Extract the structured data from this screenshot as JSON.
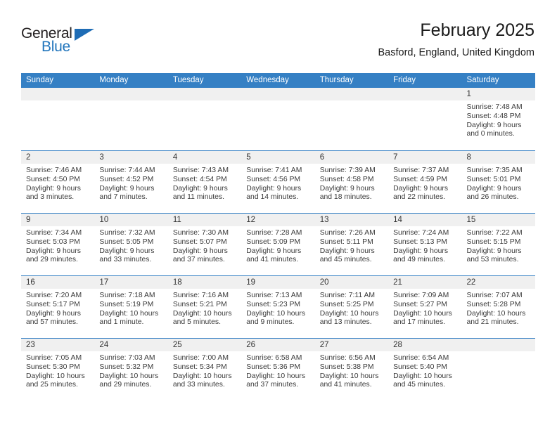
{
  "brand": {
    "name_part1": "General",
    "name_part2": "Blue",
    "triangle_icon": "triangle-icon",
    "accent_color": "#2175bc"
  },
  "header": {
    "title": "February 2025",
    "subtitle": "Basford, England, United Kingdom"
  },
  "calendar": {
    "header_bg": "#3580c4",
    "daynum_bg": "#f0f0f0",
    "weekday_headers": [
      "Sunday",
      "Monday",
      "Tuesday",
      "Wednesday",
      "Thursday",
      "Friday",
      "Saturday"
    ],
    "weeks": [
      [
        {
          "day": "",
          "empty": true
        },
        {
          "day": "",
          "empty": true
        },
        {
          "day": "",
          "empty": true
        },
        {
          "day": "",
          "empty": true
        },
        {
          "day": "",
          "empty": true
        },
        {
          "day": "",
          "empty": true
        },
        {
          "day": "1",
          "sunrise": "Sunrise: 7:48 AM",
          "sunset": "Sunset: 4:48 PM",
          "daylight1": "Daylight: 9 hours",
          "daylight2": "and 0 minutes."
        }
      ],
      [
        {
          "day": "2",
          "sunrise": "Sunrise: 7:46 AM",
          "sunset": "Sunset: 4:50 PM",
          "daylight1": "Daylight: 9 hours",
          "daylight2": "and 3 minutes."
        },
        {
          "day": "3",
          "sunrise": "Sunrise: 7:44 AM",
          "sunset": "Sunset: 4:52 PM",
          "daylight1": "Daylight: 9 hours",
          "daylight2": "and 7 minutes."
        },
        {
          "day": "4",
          "sunrise": "Sunrise: 7:43 AM",
          "sunset": "Sunset: 4:54 PM",
          "daylight1": "Daylight: 9 hours",
          "daylight2": "and 11 minutes."
        },
        {
          "day": "5",
          "sunrise": "Sunrise: 7:41 AM",
          "sunset": "Sunset: 4:56 PM",
          "daylight1": "Daylight: 9 hours",
          "daylight2": "and 14 minutes."
        },
        {
          "day": "6",
          "sunrise": "Sunrise: 7:39 AM",
          "sunset": "Sunset: 4:58 PM",
          "daylight1": "Daylight: 9 hours",
          "daylight2": "and 18 minutes."
        },
        {
          "day": "7",
          "sunrise": "Sunrise: 7:37 AM",
          "sunset": "Sunset: 4:59 PM",
          "daylight1": "Daylight: 9 hours",
          "daylight2": "and 22 minutes."
        },
        {
          "day": "8",
          "sunrise": "Sunrise: 7:35 AM",
          "sunset": "Sunset: 5:01 PM",
          "daylight1": "Daylight: 9 hours",
          "daylight2": "and 26 minutes."
        }
      ],
      [
        {
          "day": "9",
          "sunrise": "Sunrise: 7:34 AM",
          "sunset": "Sunset: 5:03 PM",
          "daylight1": "Daylight: 9 hours",
          "daylight2": "and 29 minutes."
        },
        {
          "day": "10",
          "sunrise": "Sunrise: 7:32 AM",
          "sunset": "Sunset: 5:05 PM",
          "daylight1": "Daylight: 9 hours",
          "daylight2": "and 33 minutes."
        },
        {
          "day": "11",
          "sunrise": "Sunrise: 7:30 AM",
          "sunset": "Sunset: 5:07 PM",
          "daylight1": "Daylight: 9 hours",
          "daylight2": "and 37 minutes."
        },
        {
          "day": "12",
          "sunrise": "Sunrise: 7:28 AM",
          "sunset": "Sunset: 5:09 PM",
          "daylight1": "Daylight: 9 hours",
          "daylight2": "and 41 minutes."
        },
        {
          "day": "13",
          "sunrise": "Sunrise: 7:26 AM",
          "sunset": "Sunset: 5:11 PM",
          "daylight1": "Daylight: 9 hours",
          "daylight2": "and 45 minutes."
        },
        {
          "day": "14",
          "sunrise": "Sunrise: 7:24 AM",
          "sunset": "Sunset: 5:13 PM",
          "daylight1": "Daylight: 9 hours",
          "daylight2": "and 49 minutes."
        },
        {
          "day": "15",
          "sunrise": "Sunrise: 7:22 AM",
          "sunset": "Sunset: 5:15 PM",
          "daylight1": "Daylight: 9 hours",
          "daylight2": "and 53 minutes."
        }
      ],
      [
        {
          "day": "16",
          "sunrise": "Sunrise: 7:20 AM",
          "sunset": "Sunset: 5:17 PM",
          "daylight1": "Daylight: 9 hours",
          "daylight2": "and 57 minutes."
        },
        {
          "day": "17",
          "sunrise": "Sunrise: 7:18 AM",
          "sunset": "Sunset: 5:19 PM",
          "daylight1": "Daylight: 10 hours",
          "daylight2": "and 1 minute."
        },
        {
          "day": "18",
          "sunrise": "Sunrise: 7:16 AM",
          "sunset": "Sunset: 5:21 PM",
          "daylight1": "Daylight: 10 hours",
          "daylight2": "and 5 minutes."
        },
        {
          "day": "19",
          "sunrise": "Sunrise: 7:13 AM",
          "sunset": "Sunset: 5:23 PM",
          "daylight1": "Daylight: 10 hours",
          "daylight2": "and 9 minutes."
        },
        {
          "day": "20",
          "sunrise": "Sunrise: 7:11 AM",
          "sunset": "Sunset: 5:25 PM",
          "daylight1": "Daylight: 10 hours",
          "daylight2": "and 13 minutes."
        },
        {
          "day": "21",
          "sunrise": "Sunrise: 7:09 AM",
          "sunset": "Sunset: 5:27 PM",
          "daylight1": "Daylight: 10 hours",
          "daylight2": "and 17 minutes."
        },
        {
          "day": "22",
          "sunrise": "Sunrise: 7:07 AM",
          "sunset": "Sunset: 5:28 PM",
          "daylight1": "Daylight: 10 hours",
          "daylight2": "and 21 minutes."
        }
      ],
      [
        {
          "day": "23",
          "sunrise": "Sunrise: 7:05 AM",
          "sunset": "Sunset: 5:30 PM",
          "daylight1": "Daylight: 10 hours",
          "daylight2": "and 25 minutes."
        },
        {
          "day": "24",
          "sunrise": "Sunrise: 7:03 AM",
          "sunset": "Sunset: 5:32 PM",
          "daylight1": "Daylight: 10 hours",
          "daylight2": "and 29 minutes."
        },
        {
          "day": "25",
          "sunrise": "Sunrise: 7:00 AM",
          "sunset": "Sunset: 5:34 PM",
          "daylight1": "Daylight: 10 hours",
          "daylight2": "and 33 minutes."
        },
        {
          "day": "26",
          "sunrise": "Sunrise: 6:58 AM",
          "sunset": "Sunset: 5:36 PM",
          "daylight1": "Daylight: 10 hours",
          "daylight2": "and 37 minutes."
        },
        {
          "day": "27",
          "sunrise": "Sunrise: 6:56 AM",
          "sunset": "Sunset: 5:38 PM",
          "daylight1": "Daylight: 10 hours",
          "daylight2": "and 41 minutes."
        },
        {
          "day": "28",
          "sunrise": "Sunrise: 6:54 AM",
          "sunset": "Sunset: 5:40 PM",
          "daylight1": "Daylight: 10 hours",
          "daylight2": "and 45 minutes."
        },
        {
          "day": "",
          "empty": true
        }
      ]
    ]
  }
}
